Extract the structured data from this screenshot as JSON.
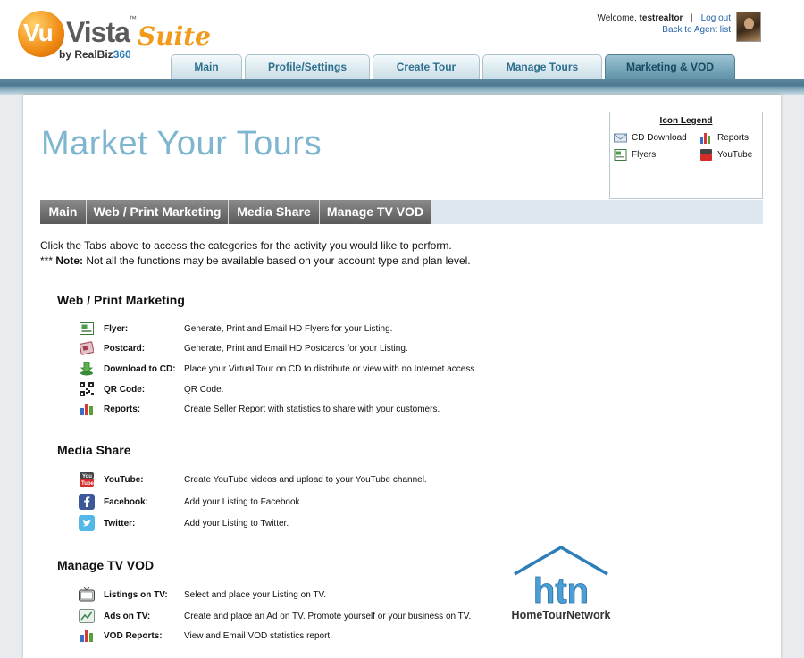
{
  "header": {
    "logo": {
      "vu": "Vu",
      "vista": "Vista",
      "tm": "™",
      "suite": "Suite",
      "by": "by RealBiz",
      "biz360": "360"
    },
    "welcome_text": "Welcome,",
    "username": "testrealtor",
    "separator": "|",
    "logout": "Log out",
    "back_link": "Back to Agent list",
    "tabs": [
      {
        "label": "Main"
      },
      {
        "label": "Profile/Settings"
      },
      {
        "label": "Create Tour"
      },
      {
        "label": "Manage Tours"
      },
      {
        "label": "Marketing & VOD"
      }
    ],
    "active_tab": "Marketing & VOD"
  },
  "page": {
    "title": "Market Your Tours",
    "legend": {
      "title": "Icon Legend",
      "items": [
        {
          "label": "CD Download",
          "icon": "envelope-icon"
        },
        {
          "label": "Reports",
          "icon": "bar-chart-icon"
        },
        {
          "label": "Flyers",
          "icon": "flyer-icon"
        },
        {
          "label": "YouTube",
          "icon": "youtube-icon"
        }
      ]
    },
    "subtabs": [
      {
        "label": "Main"
      },
      {
        "label": "Web / Print Marketing"
      },
      {
        "label": "Media Share"
      },
      {
        "label": "Manage TV VOD"
      }
    ],
    "intro_line1": "Click the Tabs above to access the categories for the activity you would like to perform.",
    "intro_note_prefix": "*** ",
    "intro_note_label": "Note:",
    "intro_note_text": " Not all the functions may be available based on your account type and plan level.",
    "sections": {
      "web_print": {
        "heading": "Web / Print Marketing",
        "rows": [
          {
            "label": "Flyer:",
            "desc": "Generate, Print and Email HD Flyers for your Listing."
          },
          {
            "label": "Postcard:",
            "desc": "Generate, Print and Email HD Postcards for your Listing."
          },
          {
            "label": "Download to CD:",
            "desc": "Place your Virtual Tour on CD to distribute or view with no Internet access."
          },
          {
            "label": "QR Code:",
            "desc": "QR Code."
          },
          {
            "label": "Reports:",
            "desc": "Create Seller Report with statistics to share with your customers."
          }
        ]
      },
      "media_share": {
        "heading": "Media Share",
        "rows": [
          {
            "label": "YouTube:",
            "desc": "Create YouTube videos and upload to your YouTube channel."
          },
          {
            "label": "Facebook:",
            "desc": "Add your Listing to Facebook."
          },
          {
            "label": "Twitter:",
            "desc": "Add your Listing to Twitter."
          }
        ]
      },
      "tv_vod": {
        "heading": "Manage TV VOD",
        "rows": [
          {
            "label": "Listings on TV:",
            "desc": "Select and place your Listing on TV."
          },
          {
            "label": "Ads on TV:",
            "desc": "Create and place an Ad on TV. Promote yourself or your business on TV."
          },
          {
            "label": "VOD Reports:",
            "desc": "View and Email VOD statistics report."
          }
        ]
      }
    },
    "htn_logo": {
      "letters": "htn",
      "name": "HomeTourNetwork"
    }
  },
  "colors": {
    "accent_orange": "#f19a1b",
    "title_blue": "#7fb6cf",
    "tab_text": "#2e6f8e",
    "subtab_bg": "#6e6e6e",
    "htn_blue": "#2d7db8"
  }
}
